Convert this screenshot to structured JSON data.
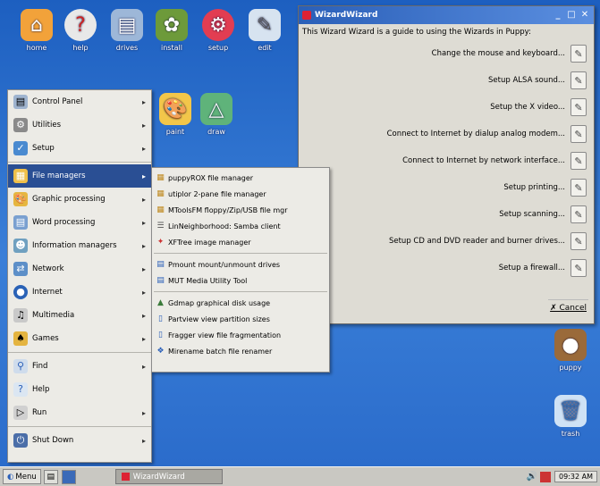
{
  "desktop_icons": [
    {
      "label": "home",
      "icon": "home-icon"
    },
    {
      "label": "help",
      "icon": "help-icon"
    },
    {
      "label": "drives",
      "icon": "drives-icon"
    },
    {
      "label": "install",
      "icon": "install-icon"
    },
    {
      "label": "setup",
      "icon": "setup-icon"
    },
    {
      "label": "edit",
      "icon": "edit-icon"
    },
    {
      "label": "paint",
      "icon": "paint-icon"
    },
    {
      "label": "draw",
      "icon": "draw-icon"
    },
    {
      "label": "trash",
      "icon": "trash-icon"
    },
    {
      "label": "puppy",
      "icon": "puppy-icon"
    }
  ],
  "start_menu": {
    "items": [
      {
        "label": "Control Panel",
        "submenu": true
      },
      {
        "label": "Utilities",
        "submenu": true
      },
      {
        "label": "Setup",
        "submenu": true
      },
      {
        "label": "File managers",
        "submenu": true,
        "active": true
      },
      {
        "label": "Graphic processing",
        "submenu": true
      },
      {
        "label": "Word processing",
        "submenu": true
      },
      {
        "label": "Information managers",
        "submenu": true
      },
      {
        "label": "Network",
        "submenu": true
      },
      {
        "label": "Internet",
        "submenu": true
      },
      {
        "label": "Multimedia",
        "submenu": true
      },
      {
        "label": "Games",
        "submenu": true
      },
      {
        "label": "Find",
        "submenu": true
      },
      {
        "label": "Help",
        "submenu": false
      },
      {
        "label": "Run",
        "submenu": true
      },
      {
        "label": "Shut Down",
        "submenu": true
      }
    ]
  },
  "submenu": {
    "items": [
      "puppyROX file manager",
      "utiplor 2-pane file manager",
      "MToolsFM floppy/Zip/USB file mgr",
      "LinNeighborhood: Samba client",
      "XFTree image manager",
      "Pmount mount/unmount drives",
      "MUT Media Utility Tool",
      "Gdmap graphical disk usage",
      "Partview view partition sizes",
      "Fragger view file fragmentation",
      "Mirename batch file renamer"
    ]
  },
  "window": {
    "title": "WizardWizard",
    "intro": "This Wizard Wizard is a guide to using the Wizards in Puppy:",
    "rows": [
      "Change the mouse and keyboard...",
      "Setup ALSA sound...",
      "Setup the X video...",
      "Connect to Internet by dialup analog modem...",
      "Connect to Internet by network interface...",
      "Setup printing...",
      "Setup scanning...",
      "Setup CD and DVD reader and burner drives...",
      "Setup a firewall..."
    ],
    "cancel_label": "Cancel"
  },
  "taskbar": {
    "menu_label": "Menu",
    "task_label": "WizardWizard",
    "clock": "09:32 AM"
  }
}
